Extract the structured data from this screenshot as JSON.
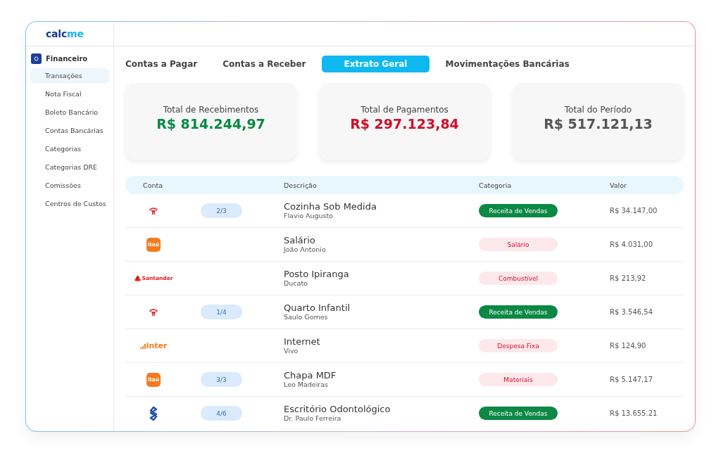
{
  "brand": {
    "part_1": "calc",
    "part_2": "me"
  },
  "sidebar": {
    "section": {
      "label": "Financeiro",
      "expanded": true
    },
    "items": [
      {
        "label": "Transações",
        "selected": true
      },
      {
        "label": "Nota Fiscal",
        "selected": false
      },
      {
        "label": "Boleto Bancário",
        "selected": false
      },
      {
        "label": "Contas Bancárias",
        "selected": false
      },
      {
        "label": "Categorias",
        "selected": false
      },
      {
        "label": "Categorias DRE",
        "selected": false
      },
      {
        "label": "Comissões",
        "selected": false
      },
      {
        "label": "Centros de Custos",
        "selected": false
      }
    ]
  },
  "tabs": [
    {
      "label": "Contas a Pagar",
      "selected": false
    },
    {
      "label": "Contas a Receber",
      "selected": false
    },
    {
      "label": "Extrato Geral",
      "selected": true
    },
    {
      "label": "Movimentações Bancárias",
      "selected": false
    }
  ],
  "summary": [
    {
      "label": "Total de Recebimentos",
      "value": "R$ 814.244,97",
      "kind": "income"
    },
    {
      "label": "Total de Pagamentos",
      "value": "R$ 297.123,84",
      "kind": "expense"
    },
    {
      "label": "Total do Período",
      "value": "R$ 517.121,13",
      "kind": "neutral"
    }
  ],
  "table": {
    "columns": [
      "Conta",
      "Descrição",
      "Categoria",
      "Valor"
    ],
    "rows": [
      {
        "account": {
          "kind": "bradesco"
        },
        "installment": "2/3",
        "description": "Cozinha Sob Medida",
        "contact": "Flavio Augusto",
        "category": {
          "label": "Receita de Vendas",
          "kind": "income"
        },
        "value": "R$ 34.147,00"
      },
      {
        "account": {
          "kind": "itau",
          "logo_text": "itaú"
        },
        "description": "Salário",
        "contact": "João Antonio",
        "category": {
          "label": "Salário",
          "kind": "expense"
        },
        "value": "R$ 4.031,00"
      },
      {
        "account": {
          "kind": "santander",
          "logo_text": "Santander"
        },
        "description": "Posto Ipiranga",
        "contact": "Ducato",
        "category": {
          "label": "Combustível",
          "kind": "expense"
        },
        "value": "R$ 213,92"
      },
      {
        "account": {
          "kind": "bradesco"
        },
        "installment": "1/4",
        "description": "Quarto Infantil",
        "contact": "Saulo Gomes",
        "category": {
          "label": "Receita de Vendas",
          "kind": "income"
        },
        "value": "R$ 3.546,54"
      },
      {
        "account": {
          "kind": "inter",
          "logo_text": "inter"
        },
        "description": "Internet",
        "contact": "Vivo",
        "category": {
          "label": "Despesa Fixa",
          "kind": "expense"
        },
        "value": "R$ 124,90"
      },
      {
        "account": {
          "kind": "itau",
          "logo_text": "itaú"
        },
        "installment": "3/3",
        "description": "Chapa MDF",
        "contact": "Leo Madeiras",
        "category": {
          "label": "Materiais",
          "kind": "expense"
        },
        "value": "R$ 5.147,17"
      },
      {
        "account": {
          "kind": "bb"
        },
        "installment": "4/6",
        "description": "Escritório Odontológico",
        "contact": "Dr. Paulo Ferreira",
        "category": {
          "label": "Receita de Vendas",
          "kind": "income"
        },
        "value": "R$ 13.655.21"
      }
    ]
  }
}
